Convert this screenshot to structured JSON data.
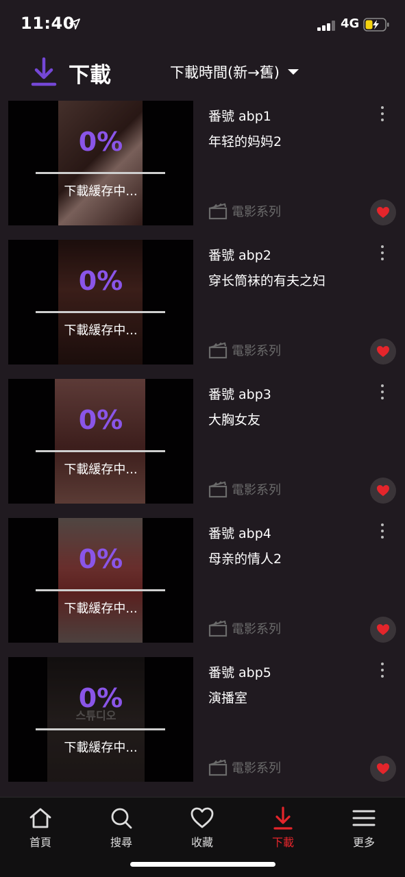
{
  "status_bar": {
    "time": "11:40",
    "network": "4G"
  },
  "header": {
    "title": "下載",
    "sort_label": "下載時間(新→舊)"
  },
  "colors": {
    "accent": "#8a55e8",
    "active_tab": "#e4252b",
    "heart": "#e4252b",
    "background": "#201a20"
  },
  "downloads": [
    {
      "code": "番號 abp1",
      "title": "年轻的妈妈2",
      "percent": "0%",
      "progress": 0,
      "status": "下載緩存中...",
      "category": "電影系列",
      "poster_text": ""
    },
    {
      "code": "番號 abp2",
      "title": "穿长筒袜的有夫之妇",
      "percent": "0%",
      "progress": 0,
      "status": "下載緩存中...",
      "category": "電影系列",
      "poster_text": ""
    },
    {
      "code": "番號 abp3",
      "title": "大胸女友",
      "percent": "0%",
      "progress": 0,
      "status": "下載緩存中...",
      "category": "電影系列",
      "poster_text": ""
    },
    {
      "code": "番號 abp4",
      "title": "母亲的情人2",
      "percent": "0%",
      "progress": 0,
      "status": "下載緩存中...",
      "category": "電影系列",
      "poster_text": ""
    },
    {
      "code": "番號 abp5",
      "title": "演播室",
      "percent": "0%",
      "progress": 0,
      "status": "下載緩存中...",
      "category": "電影系列",
      "poster_text": "스튜디오"
    }
  ],
  "tabs": [
    {
      "label": "首頁",
      "icon": "home-icon"
    },
    {
      "label": "搜尋",
      "icon": "search-icon"
    },
    {
      "label": "收藏",
      "icon": "heart-icon"
    },
    {
      "label": "下載",
      "icon": "download-icon",
      "active": true
    },
    {
      "label": "更多",
      "icon": "menu-icon"
    }
  ]
}
